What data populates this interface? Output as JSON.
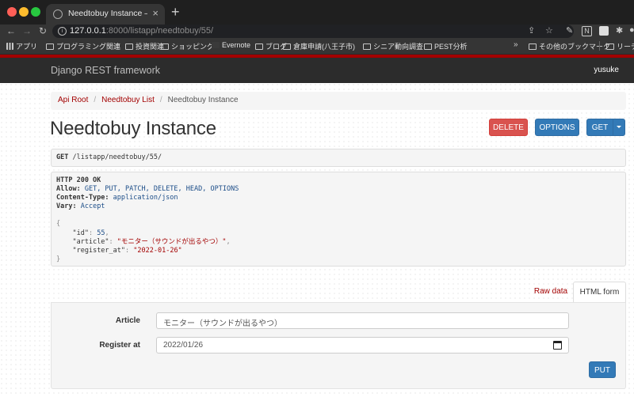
{
  "browser": {
    "tab_title": "Needtobuy Instance – Django REST framework",
    "url_host": "127.0.0.1",
    "url_path": ":8000/listapp/needtobuy/55/",
    "bookmarks": [
      "アプリ",
      "プログラミング関連",
      "投資関連",
      "ショッピング",
      "Evernote",
      "ブログ",
      "倉庫申請(八王子市)",
      "シニア動向調査",
      "PEST分析"
    ],
    "other_bookmarks": "その他のブックマーク",
    "reading_list": "リーディ",
    "more": "»"
  },
  "navbar": {
    "brand": "Django REST framework",
    "user": "yusuke"
  },
  "breadcrumb": {
    "root": "Api Root",
    "list": "Needtobuy List",
    "current": "Needtobuy Instance"
  },
  "page": {
    "title": "Needtobuy Instance"
  },
  "actions": {
    "delete": "DELETE",
    "options": "OPTIONS",
    "get": "GET"
  },
  "request": {
    "method": "GET",
    "path": "/listapp/needtobuy/55/"
  },
  "response": {
    "status": "HTTP 200 OK",
    "allow_key": "Allow:",
    "allow_value": "GET, PUT, PATCH, DELETE, HEAD, OPTIONS",
    "content_type_key": "Content-Type:",
    "content_type_value": "application/json",
    "vary_key": "Vary:",
    "vary_value": "Accept",
    "brace_open": "{",
    "brace_close": "}",
    "id_key": "\"id\"",
    "id_value": "55",
    "article_key": "\"article\"",
    "article_value": "\"モニター（サウンドが出るやつ）\"",
    "register_key": "\"register_at\"",
    "register_value": "\"2022-01-26\""
  },
  "form": {
    "tab_raw": "Raw data",
    "tab_html": "HTML form",
    "article_label": "Article",
    "article_value": "モニター（サウンドが出るやつ）",
    "register_label": "Register at",
    "register_value": "2022/01/26",
    "put": "PUT"
  }
}
